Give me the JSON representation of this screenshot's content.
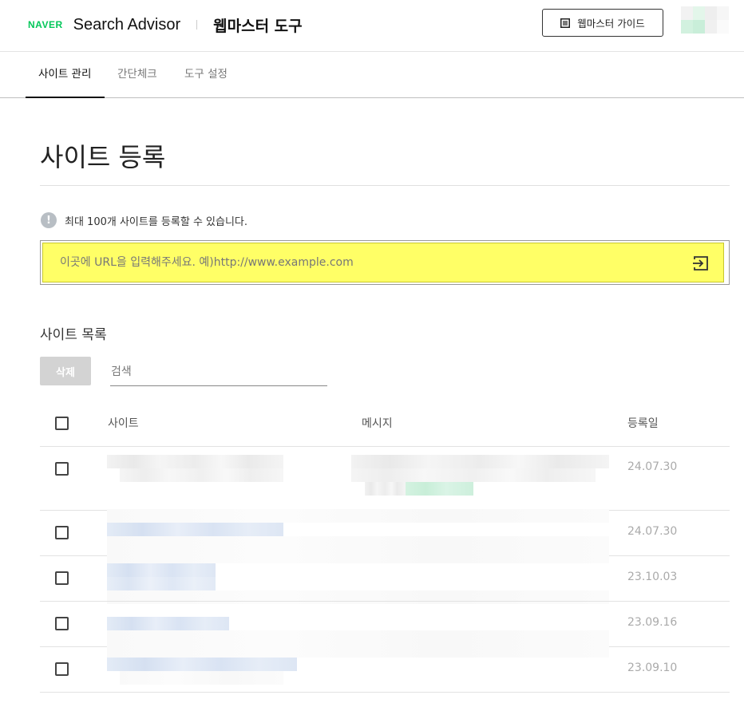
{
  "header": {
    "brand": "NAVER",
    "product": "Search Advisor",
    "tool_title": "웹마스터 도구",
    "guide_button": "웹마스터 가이드"
  },
  "tabs": [
    {
      "label": "사이트 관리",
      "active": true
    },
    {
      "label": "간단체크",
      "active": false
    },
    {
      "label": "도구 설정",
      "active": false
    }
  ],
  "page": {
    "title": "사이트 등록",
    "notice": "최대 100개 사이트를 등록할 수 있습니다.",
    "url_placeholder": "이곳에 URL을 입력해주세요. 예)http://www.example.com"
  },
  "site_list": {
    "title": "사이트 목록",
    "delete_button": "삭제",
    "search_placeholder": "검색",
    "columns": [
      "사이트",
      "메시지",
      "등록일"
    ],
    "rows": [
      {
        "date": "24.07.30"
      },
      {
        "date": "24.07.30"
      },
      {
        "date": "23.10.03"
      },
      {
        "date": "23.09.16"
      },
      {
        "date": "23.09.10"
      }
    ]
  },
  "colors": {
    "naver_green": "#03c75a",
    "highlight": "#ffff66"
  }
}
